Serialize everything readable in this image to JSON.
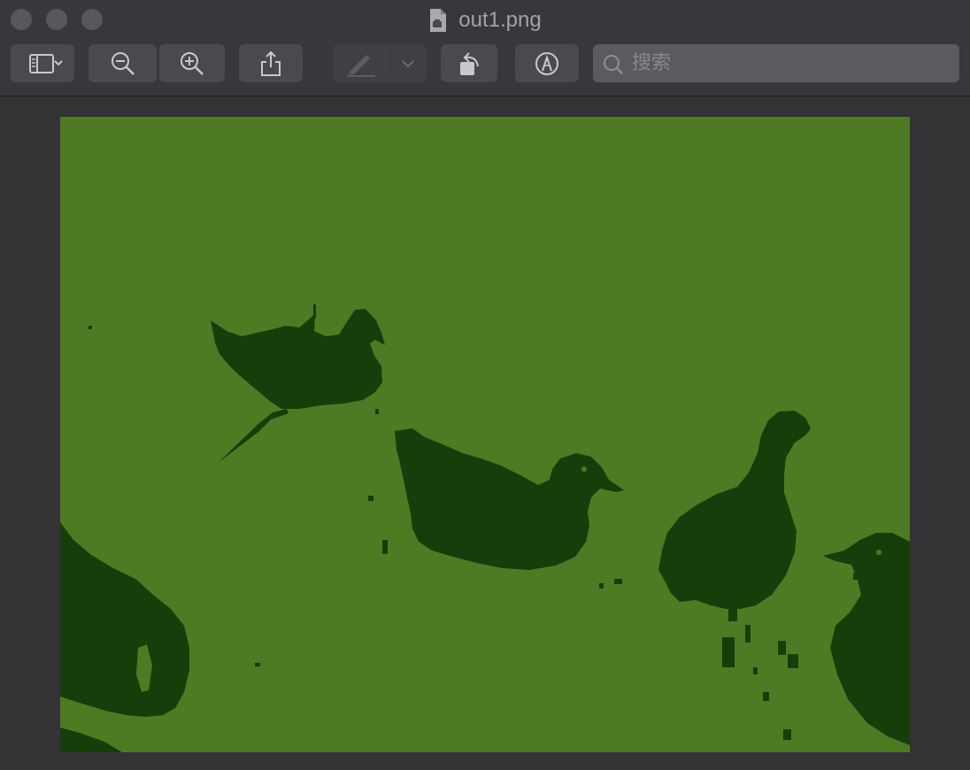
{
  "window": {
    "title": "out1.png"
  },
  "toolbar": {
    "sidebar_icon": "sidebar-icon",
    "zoom_out_icon": "zoom-out-icon",
    "zoom_in_icon": "zoom-in-icon",
    "share_icon": "share-icon",
    "highlight_icon": "pen-icon",
    "rotate_icon": "rotate-icon",
    "markup_icon": "markup-icon"
  },
  "search": {
    "placeholder": "搜索",
    "value": ""
  },
  "image": {
    "description_colors": {
      "background": "#4f7a24",
      "foreground": "#173d0a"
    }
  }
}
